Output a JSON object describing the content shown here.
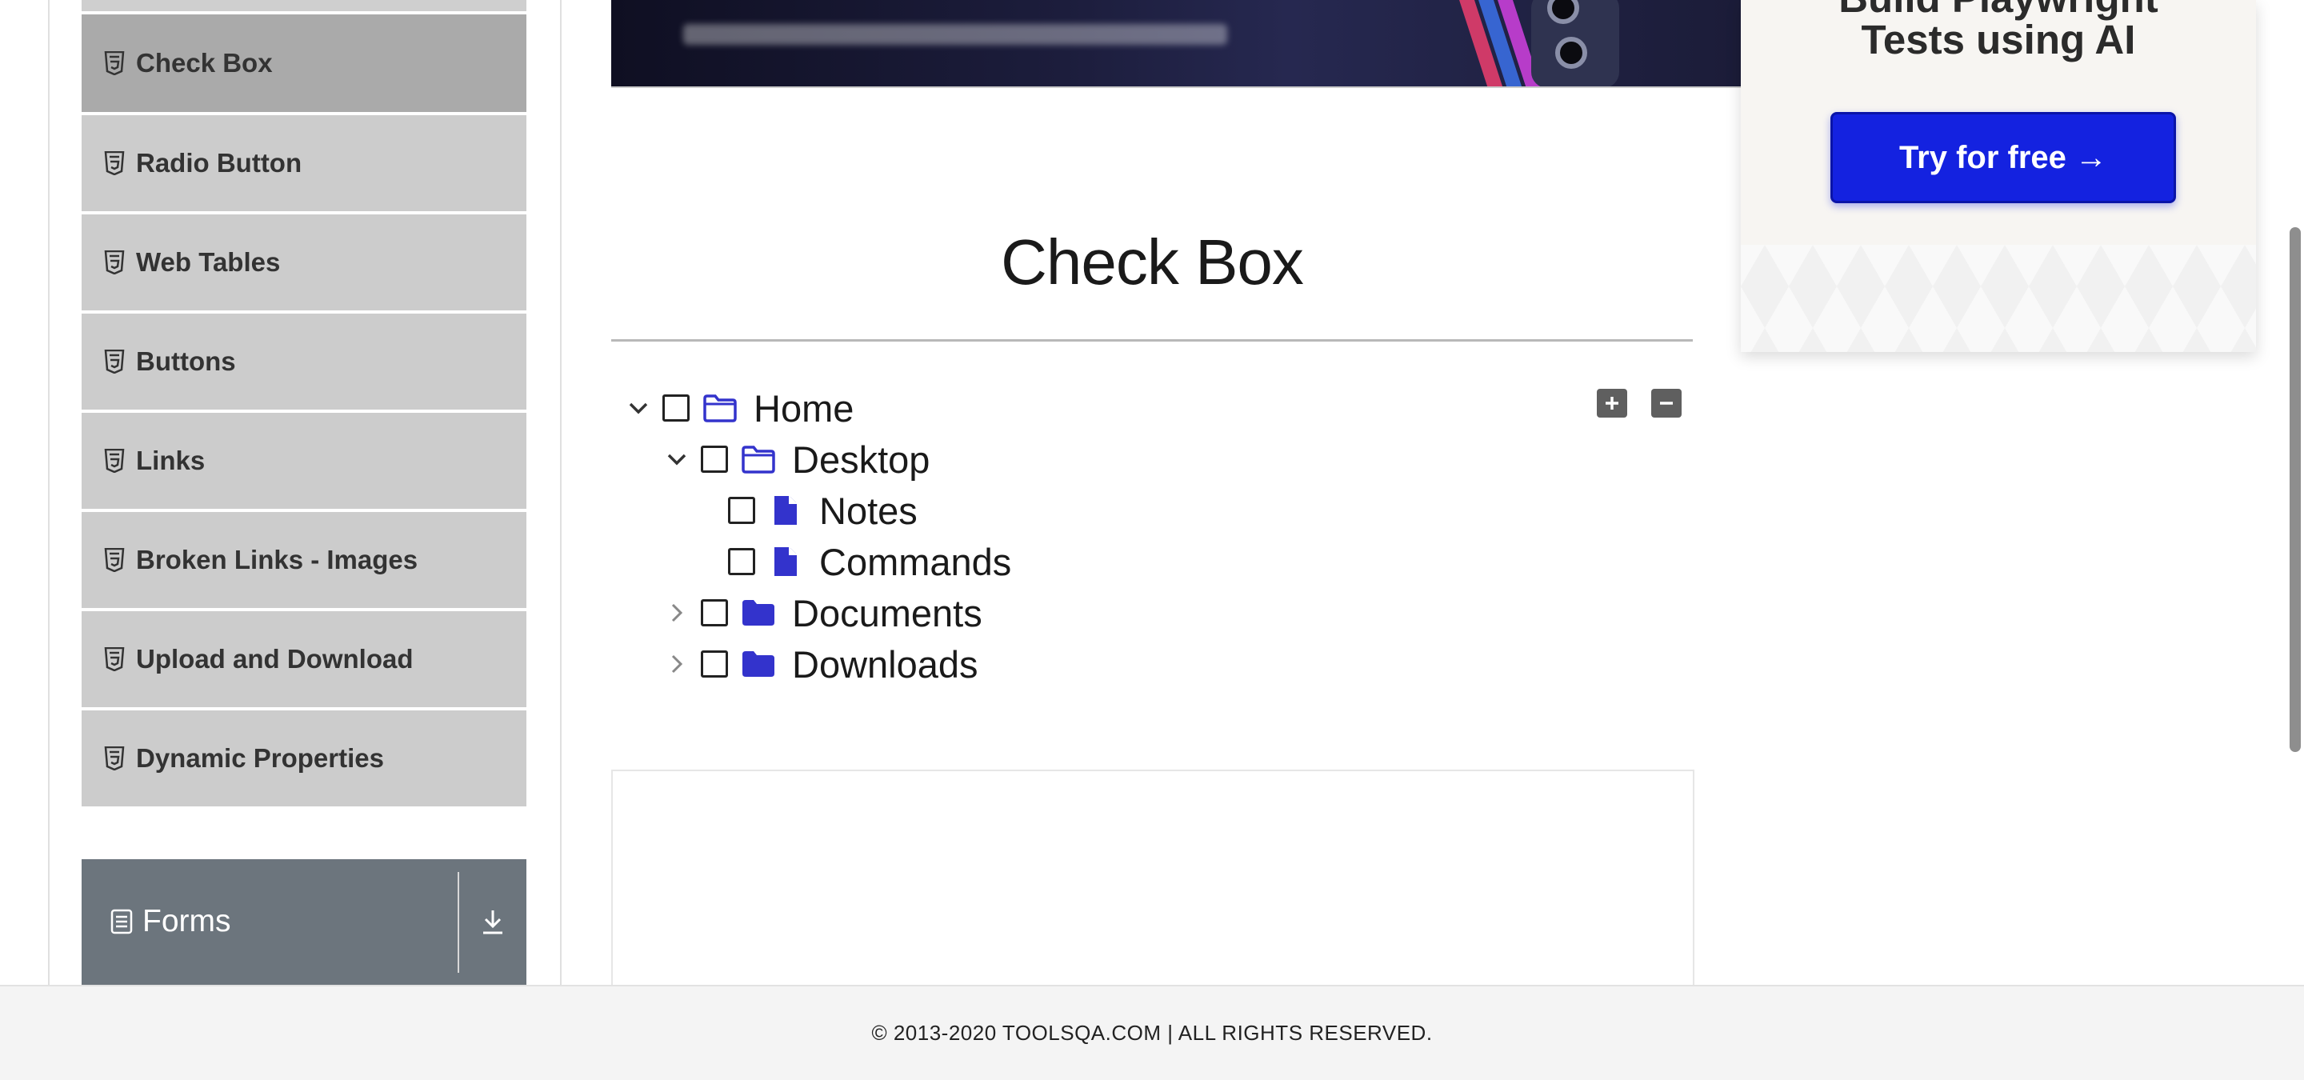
{
  "sidebar": {
    "items": [
      {
        "label": "Check Box",
        "icon": "html5-icon",
        "active": true
      },
      {
        "label": "Radio Button",
        "icon": "html5-icon"
      },
      {
        "label": "Web Tables",
        "icon": "html5-icon"
      },
      {
        "label": "Buttons",
        "icon": "html5-icon"
      },
      {
        "label": "Links",
        "icon": "html5-icon"
      },
      {
        "label": "Broken Links - Images",
        "icon": "html5-icon"
      },
      {
        "label": "Upload and Download",
        "icon": "html5-icon"
      },
      {
        "label": "Dynamic Properties",
        "icon": "html5-icon"
      }
    ],
    "next_group": {
      "label": "Forms",
      "icon": "form-document-icon",
      "toggle_icon": "download-arrow-icon"
    }
  },
  "ad": {
    "title_partial": "Build Playwright",
    "title": "Tests using AI",
    "cta": "Try for free →",
    "cta_color": "#1422e0"
  },
  "main": {
    "title": "Check Box",
    "tree": {
      "home": {
        "label": "Home",
        "expanded": true,
        "checked": false
      },
      "desktop": {
        "label": "Desktop",
        "expanded": true,
        "checked": false
      },
      "notes": {
        "label": "Notes",
        "checked": false
      },
      "commands": {
        "label": "Commands",
        "checked": false
      },
      "documents": {
        "label": "Documents",
        "expanded": false,
        "checked": false
      },
      "downloads": {
        "label": "Downloads",
        "expanded": false,
        "checked": false
      }
    },
    "controls": {
      "expand_all": "plus-square-icon",
      "collapse_all": "minus-square-icon"
    },
    "accent_color": "#3333cc"
  },
  "footer": {
    "text": "© 2013-2020 TOOLSQA.COM | ALL RIGHTS RESERVED."
  }
}
